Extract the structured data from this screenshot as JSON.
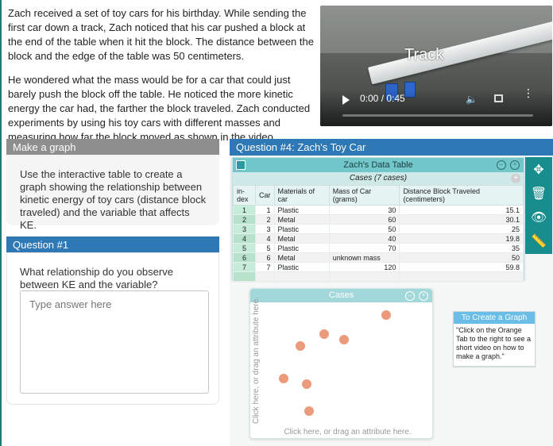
{
  "intro": {
    "p1": "Zach received a set of toy cars for his birthday. While sending the first car down a track, Zach noticed that his car pushed a block at the end of the table when it hit the block. The distance between the block and the edge of the table was 50 centimeters.",
    "p2": "He wondered what the mass would be for a car that could just barely push the block off the table. He noticed the more kinetic energy the car had, the farther the block traveled. Zach conducted experiments by using his toy cars with different masses and measuring how far the block moved as shown in the video."
  },
  "video": {
    "overlay_text": "Track",
    "time": "0:00 / 0:45",
    "play_icon": "play-icon",
    "volume_icon": "volume-icon",
    "fullscreen_icon": "fullscreen-icon",
    "menu_icon": "more-options-icon",
    "progress": 0
  },
  "make_graph": {
    "title": "Make a graph",
    "text": "Use the interactive table to create a graph showing the relationship between kinetic energy of toy cars (distance block traveled) and the variable that affects KE."
  },
  "question1": {
    "title": "Question #1",
    "prompt": "What relationship do you observe between KE and the variable?",
    "placeholder": "Type answer here"
  },
  "question4": {
    "title": "Question #4: Zach's Toy Car"
  },
  "data_table": {
    "title": "Zach's Data Table",
    "cases_label": "Cases (7 cases)",
    "columns": [
      "in-dex",
      "Car",
      "Materials of car",
      "Mass of Car (grams)",
      "Distance Block Traveled (centimeters)"
    ],
    "rows": [
      {
        "index": "1",
        "car": "1",
        "material": "Plastic",
        "mass": "30",
        "distance": "15.1"
      },
      {
        "index": "2",
        "car": "2",
        "material": "Metal",
        "mass": "60",
        "distance": "30.1"
      },
      {
        "index": "3",
        "car": "3",
        "material": "Plastic",
        "mass": "50",
        "distance": "25"
      },
      {
        "index": "4",
        "car": "4",
        "material": "Metal",
        "mass": "40",
        "distance": "19.8"
      },
      {
        "index": "5",
        "car": "5",
        "material": "Plastic",
        "mass": "70",
        "distance": "35"
      },
      {
        "index": "6",
        "car": "6",
        "material": "Metal",
        "mass": "unknown mass",
        "distance": "50"
      },
      {
        "index": "7",
        "car": "7",
        "material": "Plastic",
        "mass": "120",
        "distance": "59.8"
      }
    ]
  },
  "tools": [
    "move-icon",
    "trash-icon",
    "eye-icon",
    "ruler-icon"
  ],
  "graph": {
    "title": "Cases",
    "y_axis_prompt": "Click here, or drag an attribute here.",
    "x_axis_prompt": "Click here, or drag an attribute here.",
    "dots": [
      {
        "fx": 0.73,
        "fy": 0.1
      },
      {
        "fx": 0.36,
        "fy": 0.25
      },
      {
        "fx": 0.48,
        "fy": 0.3
      },
      {
        "fx": 0.22,
        "fy": 0.35
      },
      {
        "fx": 0.12,
        "fy": 0.62
      },
      {
        "fx": 0.26,
        "fy": 0.66
      },
      {
        "fx": 0.27,
        "fy": 0.88
      }
    ]
  },
  "note": {
    "title": "To Create a Graph",
    "text": "\"Click on the Orange Tab to the right to see a short video on how to make a graph.\""
  }
}
